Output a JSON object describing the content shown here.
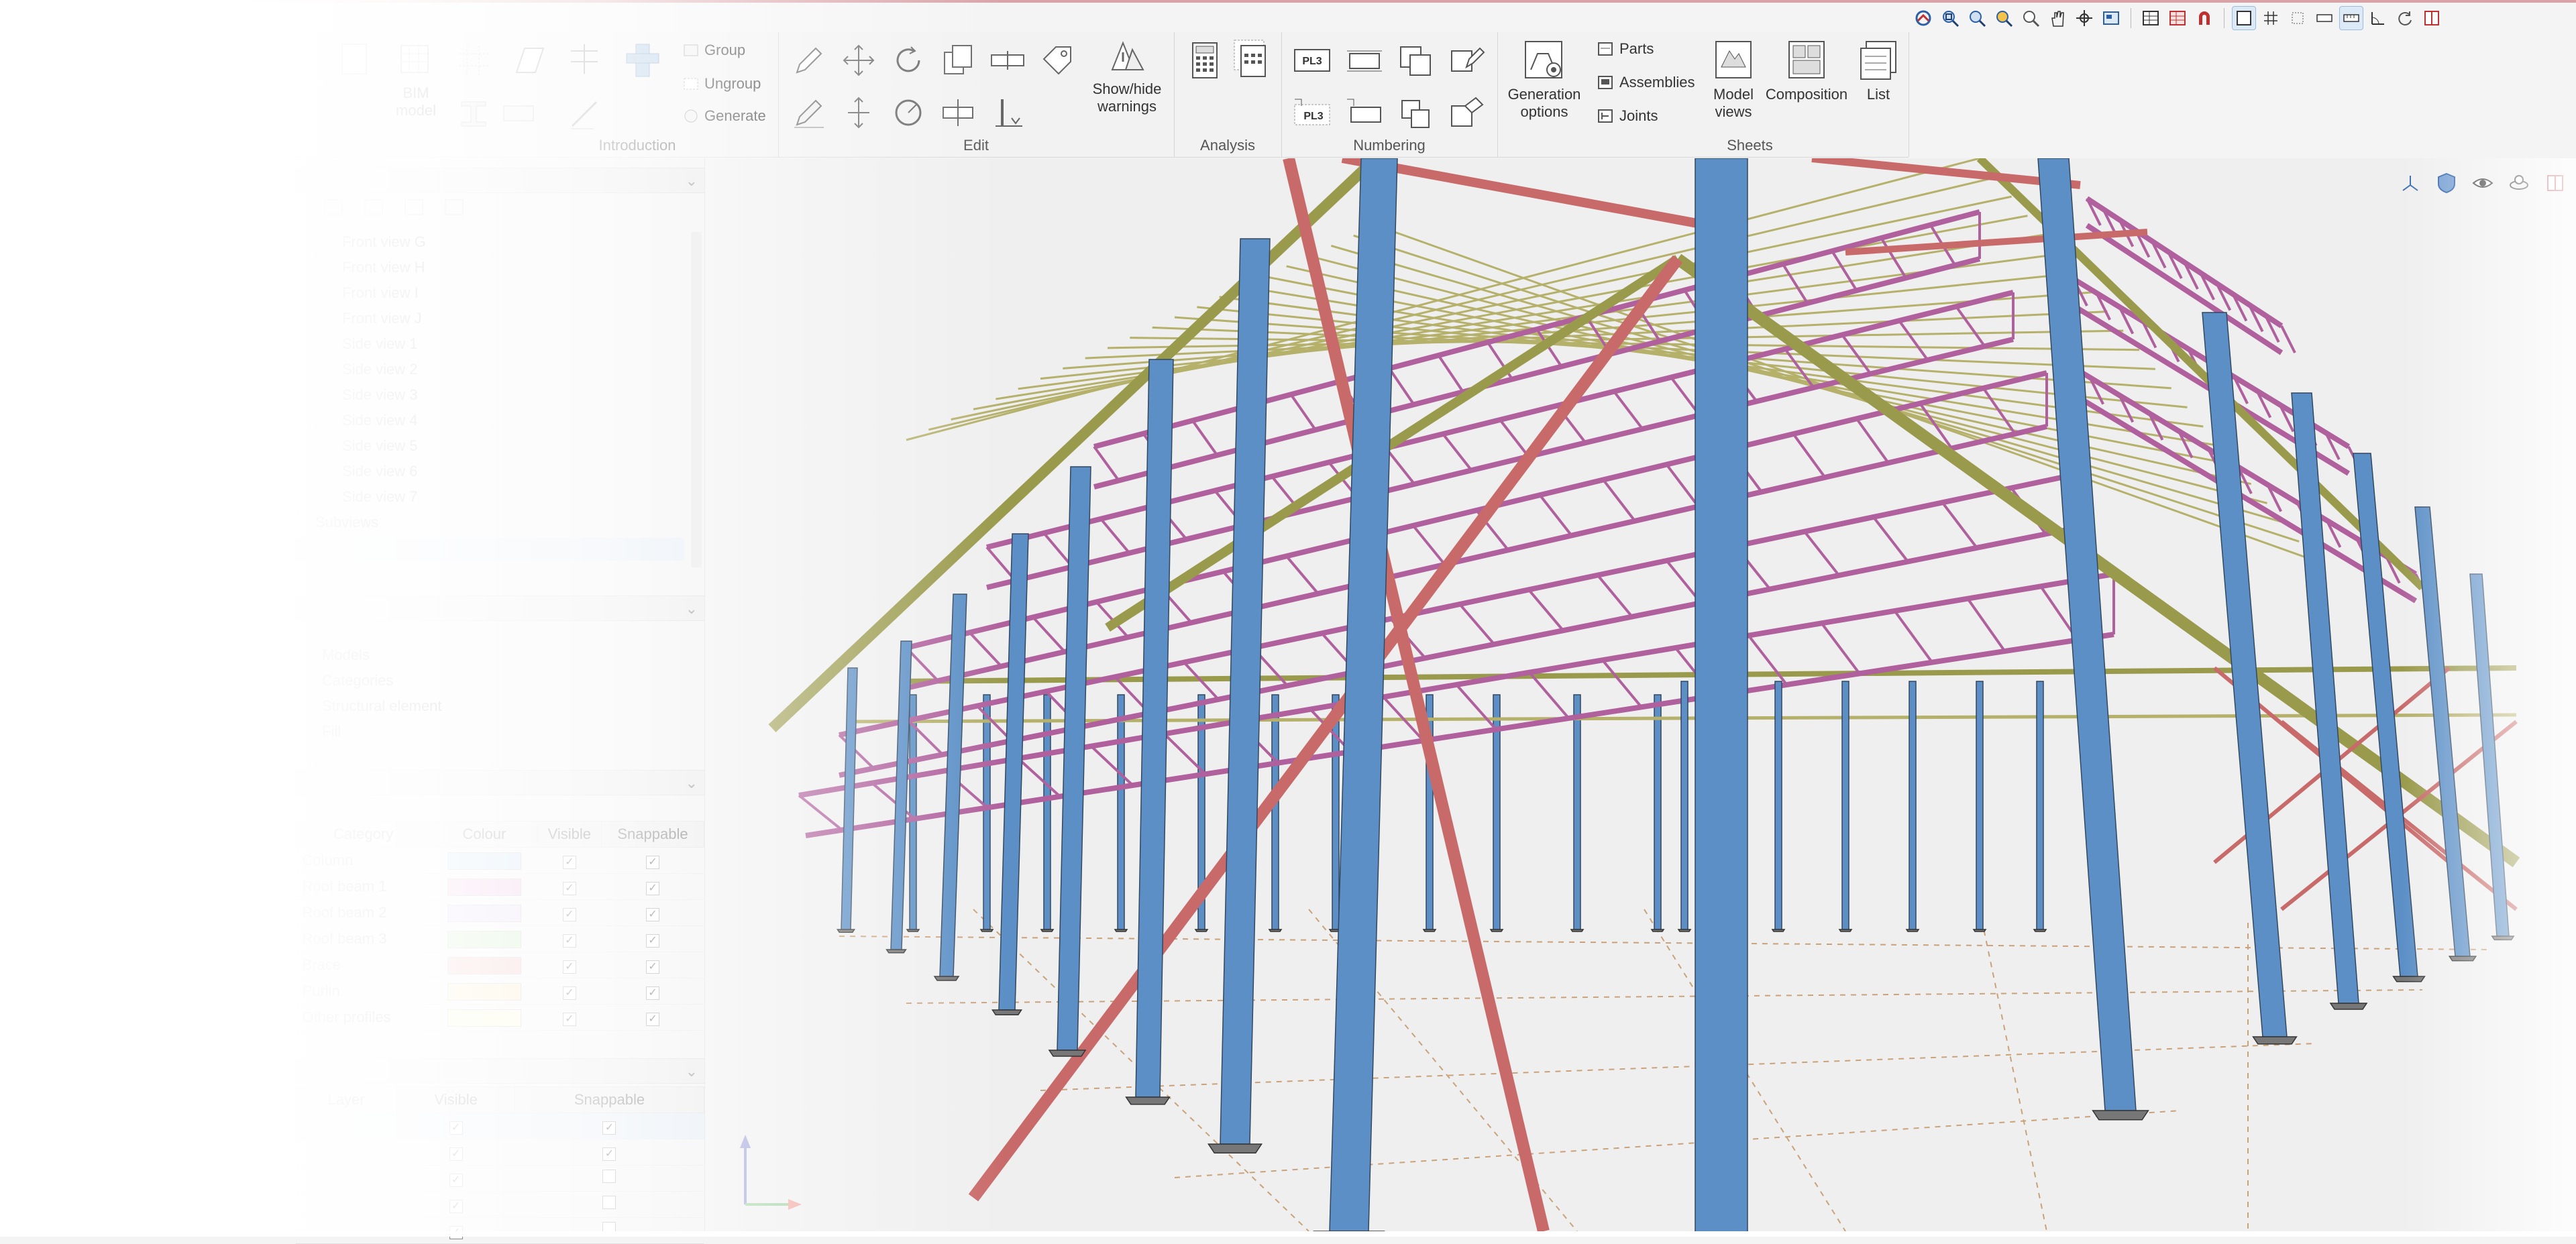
{
  "ribbon": {
    "introduction": {
      "label": "Introduction",
      "group_btn": "Group",
      "ungroup_btn": "Ungroup",
      "generate_btn": "Generate",
      "bim_model": "BIM model"
    },
    "edit": {
      "label": "Edit",
      "show_hide_warnings": "Show/hide warnings"
    },
    "analysis": {
      "label": "Analysis"
    },
    "numbering": {
      "label": "Numbering",
      "pl_tag": "PL3"
    },
    "generation_options": "Generation options",
    "sheets": {
      "label": "Sheets",
      "parts": "Parts",
      "assemblies": "Assemblies",
      "joints": "Joints",
      "model_views": "Model views",
      "composition": "Composition",
      "list": "List"
    }
  },
  "left_panel": {
    "views": [
      "Front view G",
      "Front view H",
      "Front view I",
      "Front view J",
      "Side view 1",
      "Side view 2",
      "Side view 3",
      "Side view 4",
      "Side view 5",
      "Side view 6",
      "Side view 7"
    ],
    "subviews_label": "Subviews",
    "layers": [
      "Models",
      "Categories",
      "Structural element",
      "Fill"
    ],
    "colour_table": {
      "headers": [
        "Category",
        "Colour",
        "Visible",
        "Snappable"
      ],
      "rows": [
        {
          "name": "Column",
          "color": "#bcd7ee"
        },
        {
          "name": "Roof beam 1",
          "color": "#e7a7d6"
        },
        {
          "name": "Roof beam 2",
          "color": "#d9c8ee"
        },
        {
          "name": "Roof beam 3",
          "color": "#b7e3a8"
        },
        {
          "name": "Brace",
          "color": "#f0a8a8"
        },
        {
          "name": "Purlin",
          "color": "#f8e3a8"
        },
        {
          "name": "Other profiles",
          "color": "#fbf7c8"
        }
      ]
    },
    "layer_table": {
      "headers": [
        "Layer",
        "Visible",
        "Snappable"
      ]
    }
  },
  "model_colors": {
    "column": "#5b8fc6",
    "truss": "#b0619d",
    "rafter": "#9a9a4c",
    "brace": "#c96a6a",
    "purlin": "#b5b06a",
    "grid": "#c9a27a"
  }
}
